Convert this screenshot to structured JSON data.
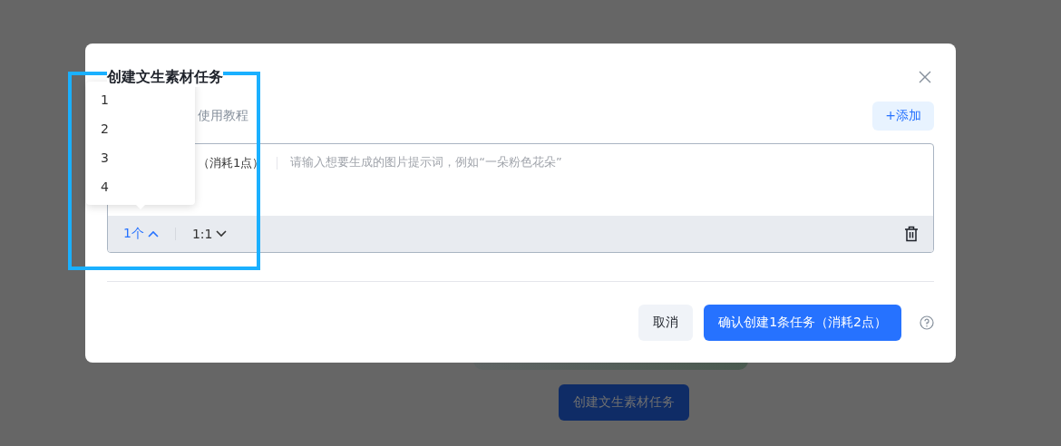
{
  "background": {
    "button": "创建文生素材任务"
  },
  "dialog": {
    "title": "创建文生素材任务",
    "tutorial_link": "使用教程",
    "add_button": "+添加",
    "prompt": {
      "label": "（消耗1点）",
      "placeholder": "请输入想要生成的图片提示词，例如“一朵粉色花朵”",
      "count": "1个",
      "count_expanded": true,
      "ratio": "1:1"
    },
    "buttons": [
      {
        "label": "取消",
        "kind": "secondary"
      },
      {
        "label": "确认创建1条任务（消耗2点）",
        "kind": "primary"
      }
    ]
  },
  "count_menu": {
    "options": [
      "1",
      "2",
      "3",
      "4"
    ]
  }
}
